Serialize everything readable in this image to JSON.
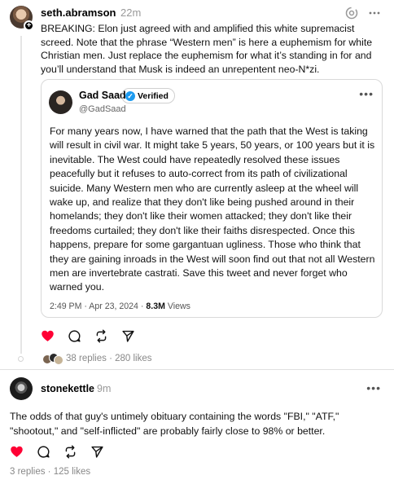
{
  "post1": {
    "username": "seth.abramson",
    "time": "22m",
    "body": "BREAKING: Elon just agreed with and amplified this white supremacist screed. Note that the phrase “Western men” is here a euphemism for white Christian men. Just replace the euphemism for what it’s standing in for and you’ll understand that Musk is indeed an unrepentent neo-N*zi.",
    "replies": "38 replies",
    "separator": " · ",
    "likes": "280 likes",
    "liked": true
  },
  "quote": {
    "name": "Gad Saad",
    "verified_label": "Verified",
    "handle": "@GadSaad",
    "text": "For many years now, I have warned that the path that the West is taking will result in civil war.  It might take 5 years, 50 years, or 100 years but it is inevitable.  The West could have repeatedly resolved these issues peacefully but it refuses to auto-correct from its path of civilizational suicide.  Many Western men who are currently asleep at the wheel will wake up, and realize that they don't like being pushed around in their homelands; they don't like their women attacked; they don't like their freedoms curtailed; they don't like their faiths disrespected.  Once this happens, prepare for some gargantuan ugliness.  Those who think that they are gaining inroads in the West will soon find out that not all Western men are invertebrate castrati.  Save this tweet and never forget who warned you.",
    "timestamp": "2:49 PM · Apr 23, 2024 · ",
    "views_count": "8.3M",
    "views_label": " Views"
  },
  "post2": {
    "username": "stonekettle",
    "time": "9m",
    "body": "The odds of that guy's untimely obituary containing the words \"FBI,\" \"ATF,\" \"shootout,\" and \"self-inflicted\" are probably fairly close to 98% or better.",
    "replies": "3 replies",
    "separator": " · ",
    "likes": "125 likes",
    "liked": true
  },
  "icons": {
    "like": "heart-icon",
    "reply": "comment-icon",
    "repost": "repost-icon",
    "share": "send-icon",
    "more": "more-icon",
    "activity": "activity-icon"
  },
  "colors": {
    "like_active": "#ff0034",
    "verified_badge": "#1d9bf0",
    "meta_text": "#888888"
  }
}
